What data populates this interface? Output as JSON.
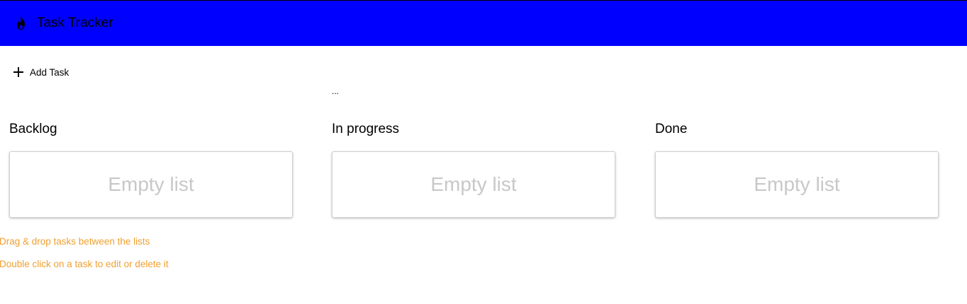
{
  "app_bar": {
    "title": "Task Tracker",
    "icon": "flame-icon",
    "background": "#0000ff"
  },
  "toolbar": {
    "add_task_label": "Add Task",
    "add_task_icon": "plus-icon"
  },
  "status": {
    "ellipsis": "..."
  },
  "columns": [
    {
      "title": "Backlog",
      "empty_text": "Empty list"
    },
    {
      "title": "In progress",
      "empty_text": "Empty list"
    },
    {
      "title": "Done",
      "empty_text": "Empty list"
    }
  ],
  "hints": [
    "Drag & drop tasks between the lists",
    "Double click on a task to edit or delete it"
  ],
  "colors": {
    "hint": "#f0a030",
    "empty_text": "#c8c8c8"
  }
}
